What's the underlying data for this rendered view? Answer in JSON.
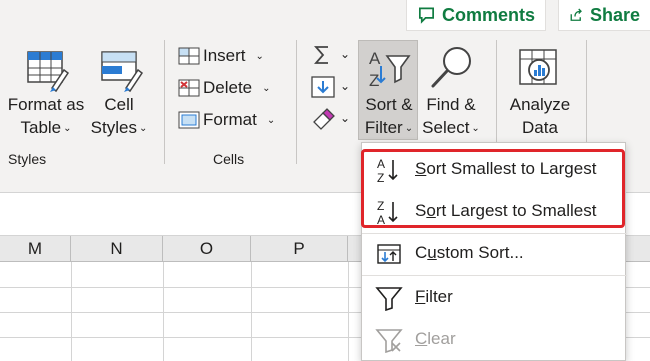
{
  "top": {
    "comments_label": "Comments",
    "share_label": "Share"
  },
  "ribbon": {
    "styles": {
      "format_as_table_line1": "Format as",
      "format_as_table_line2": "Table",
      "cell_styles_line1": "Cell",
      "cell_styles_line2": "Styles",
      "group_label": "Styles"
    },
    "cells": {
      "insert_label": "Insert",
      "delete_label": "Delete",
      "format_label": "Format",
      "group_label": "Cells"
    },
    "editing": {
      "sort_filter_line1": "Sort &",
      "sort_filter_line2": "Filter",
      "find_select_line1": "Find &",
      "find_select_line2": "Select"
    },
    "analysis": {
      "analyze_line1": "Analyze",
      "analyze_line2": "Data"
    }
  },
  "grid": {
    "columns": [
      "M",
      "N",
      "O",
      "P"
    ]
  },
  "menu": {
    "items": [
      {
        "pre": "",
        "key": "S",
        "rest": "ort Smallest to Largest",
        "enabled": true
      },
      {
        "pre": "S",
        "key": "o",
        "rest": "rt Largest to Smallest",
        "enabled": true
      },
      {
        "pre": "C",
        "key": "u",
        "rest": "stom Sort...",
        "enabled": true
      },
      {
        "pre": "",
        "key": "F",
        "rest": "ilter",
        "enabled": true
      },
      {
        "pre": "",
        "key": "C",
        "rest": "lear",
        "enabled": false
      }
    ]
  },
  "colors": {
    "accent_green": "#107c41",
    "highlight_red": "#e0252a"
  }
}
